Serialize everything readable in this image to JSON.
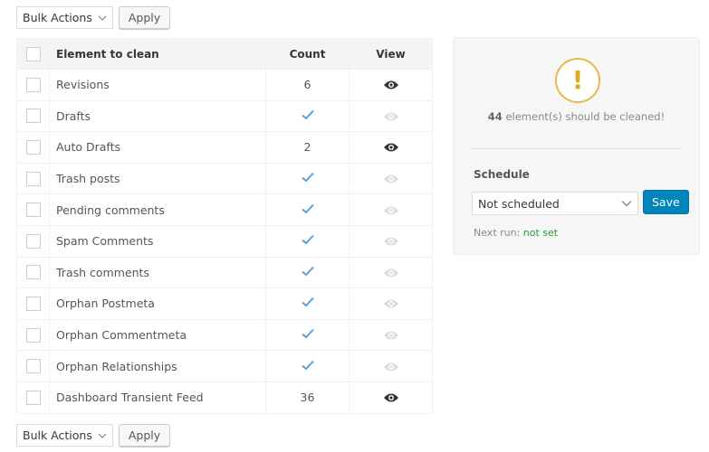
{
  "bulk_top": {
    "select_label": "Bulk Actions",
    "apply_label": "Apply"
  },
  "bulk_bottom": {
    "select_label": "Bulk Actions",
    "apply_label": "Apply"
  },
  "table": {
    "headers": {
      "element": "Element to clean",
      "count": "Count",
      "view": "View"
    },
    "rows": [
      {
        "name": "Revisions",
        "count": "6",
        "status": "count",
        "view_active": true
      },
      {
        "name": "Drafts",
        "count": "✓",
        "status": "clean",
        "view_active": false
      },
      {
        "name": "Auto Drafts",
        "count": "2",
        "status": "count",
        "view_active": true
      },
      {
        "name": "Trash posts",
        "count": "✓",
        "status": "clean",
        "view_active": false
      },
      {
        "name": "Pending comments",
        "count": "✓",
        "status": "clean",
        "view_active": false
      },
      {
        "name": "Spam Comments",
        "count": "✓",
        "status": "clean",
        "view_active": false
      },
      {
        "name": "Trash comments",
        "count": "✓",
        "status": "clean",
        "view_active": false
      },
      {
        "name": "Orphan Postmeta",
        "count": "✓",
        "status": "clean",
        "view_active": false
      },
      {
        "name": "Orphan Commentmeta",
        "count": "✓",
        "status": "clean",
        "view_active": false
      },
      {
        "name": "Orphan Relationships",
        "count": "✓",
        "status": "clean",
        "view_active": false
      },
      {
        "name": "Dashboard Transient Feed",
        "count": "36",
        "status": "count",
        "view_active": true
      }
    ]
  },
  "panel": {
    "warning_icon": "!",
    "total": "44",
    "summary_text": "element(s) should be cleaned!",
    "schedule_label": "Schedule",
    "schedule_value": "Not scheduled",
    "save_label": "Save",
    "next_run_label": "Next run:",
    "next_run_value": "not set"
  },
  "colors": {
    "accent": "#0085ba",
    "check": "#5b9dd9",
    "warning": "#e8b84a",
    "eye_active": "#333333",
    "eye_inactive": "#dddddd",
    "next_run_value": "#2a9d2a"
  }
}
